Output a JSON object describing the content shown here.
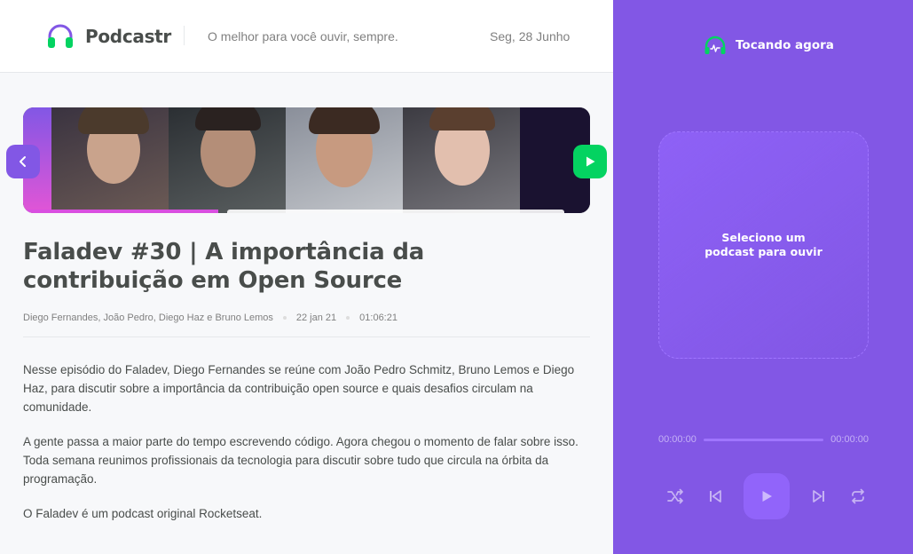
{
  "header": {
    "app_name": "Podcastr",
    "tagline": "O melhor para você ouvir, sempre.",
    "date": "Seg, 28 Junho",
    "logo_icon": "headphones-icon"
  },
  "episode": {
    "title": "Faladev #30 | A importância da contribuição em Open Source",
    "members": "Diego Fernandes, João Pedro, Diego Haz e Bruno Lemos",
    "published_at": "22 jan 21",
    "duration": "01:06:21",
    "description": [
      "Nesse episódio do Faladev, Diego Fernandes se reúne com João Pedro Schmitz, Bruno Lemos e Diego Haz, para discutir sobre a importância da contribuição open source e quais desafios circulam na comunidade.",
      "A gente passa a maior parte do tempo escrevendo código. Agora chegou o momento de falar sobre isso. Toda semana reunimos profissionais da tecnologia para discutir sobre tudo que circula na órbita da programação.",
      "O Faladev é um podcast original Rocketseat."
    ]
  },
  "player": {
    "header": "Tocando agora",
    "empty_message_line1": "Seleciono um",
    "empty_message_line2": "podcast para ouvir",
    "current_time": "00:00:00",
    "total_time": "00:00:00",
    "progress": 0,
    "controls": [
      "shuffle-icon",
      "previous-icon",
      "play-icon",
      "next-icon",
      "repeat-icon"
    ]
  },
  "colors": {
    "purple": "#8257e5",
    "green": "#04d361",
    "background": "#f7f8fa",
    "text": "#494d4b"
  }
}
